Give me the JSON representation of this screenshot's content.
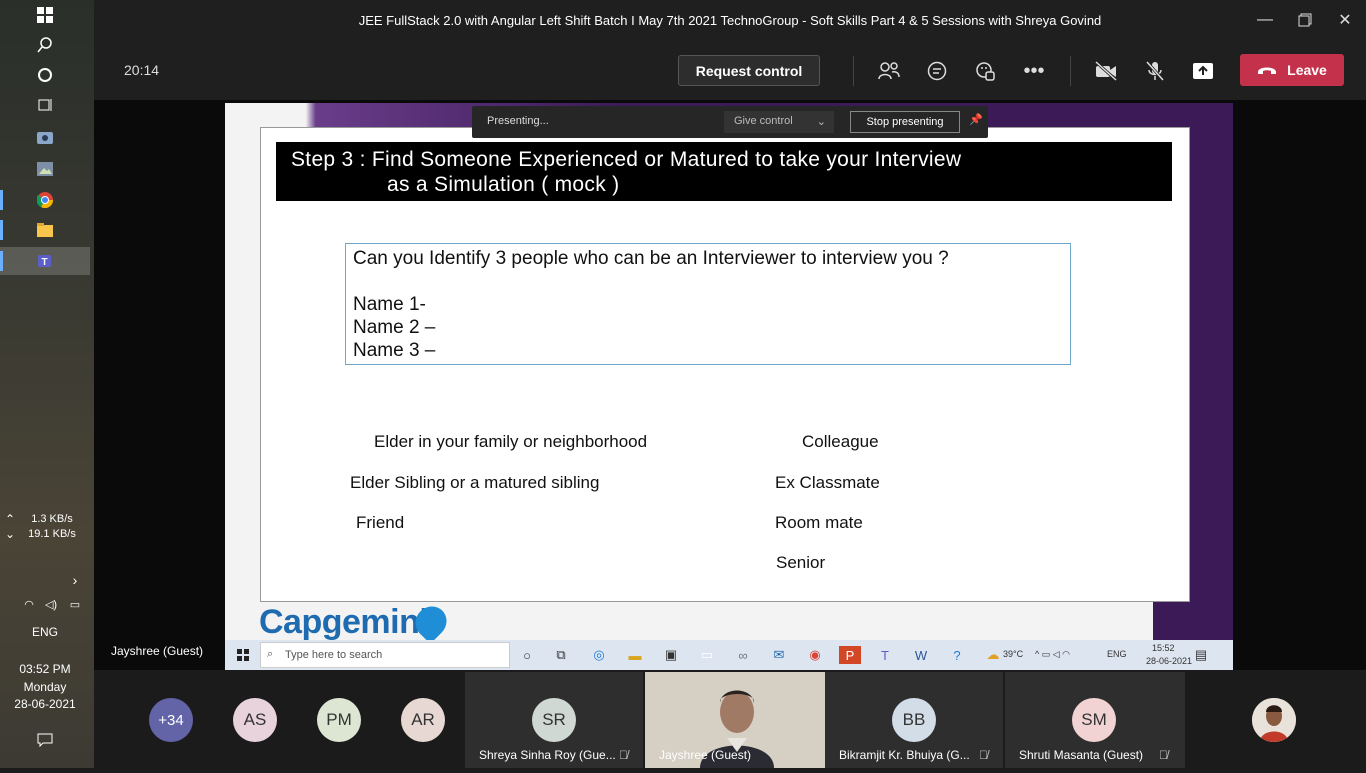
{
  "window": {
    "title": "JEE FullStack 2.0 with Angular Left Shift Batch I May 7th 2021 TechnoGroup - Soft Skills Part 4 & 5 Sessions with Shreya Govind"
  },
  "toolbar": {
    "timer": "20:14",
    "request_control": "Request control",
    "leave": "Leave"
  },
  "presenting_banner": {
    "status": "Presenting...",
    "give_control": "Give control",
    "stop_presenting": "Stop presenting"
  },
  "slide": {
    "header_line1": "Step 3 : Find Someone Experienced or Matured to take your  Interview",
    "header_line2": "as a Simulation ( mock )",
    "question": "Can you Identify 3 people who can be an Interviewer to interview you ?",
    "names": [
      "Name 1-",
      "Name 2 –",
      "Name 3 –"
    ],
    "options_left": [
      "Elder in your family or neighborhood",
      "Elder Sibling or a matured sibling",
      "Friend"
    ],
    "options_right": [
      "Colleague",
      "Ex Classmate",
      "Room mate",
      "Senior"
    ],
    "logo": "Capgemini",
    "partial_letter": "e"
  },
  "inner_taskbar": {
    "search_placeholder": "Type here to search",
    "temperature": "39°C",
    "lang": "ENG",
    "time": "15:52",
    "date": "28-06-2021"
  },
  "presenter_label": "Jayshree (Guest)",
  "left_taskbar": {
    "upload_speed": "1.3 KB/s",
    "download_speed": "19.1 KB/s",
    "lang": "ENG",
    "time": "03:52 PM",
    "day": "Monday",
    "date": "28-06-2021"
  },
  "participants": {
    "overflow": "+34",
    "avatars": [
      {
        "initials": "AS",
        "color": "#e8d3dc"
      },
      {
        "initials": "PM",
        "color": "#dce6d3"
      },
      {
        "initials": "AR",
        "color": "#e8d8d3"
      }
    ],
    "tiles": [
      {
        "initials": "SR",
        "name": "Shreya Sinha Roy (Gue...",
        "color": "#cfd8d3"
      },
      {
        "name": "Jayshree (Guest)"
      },
      {
        "initials": "BB",
        "name": "Bikramjit Kr. Bhuiya (G...",
        "color": "#d3dde8"
      },
      {
        "initials": "SM",
        "name": "Shruti Masanta (Guest)",
        "color": "#f2d3d3"
      }
    ]
  },
  "colors": {
    "leave_red": "#c4314b",
    "overflow_purple": "#6264a7",
    "capgemini_blue": "#1f6bb0"
  }
}
